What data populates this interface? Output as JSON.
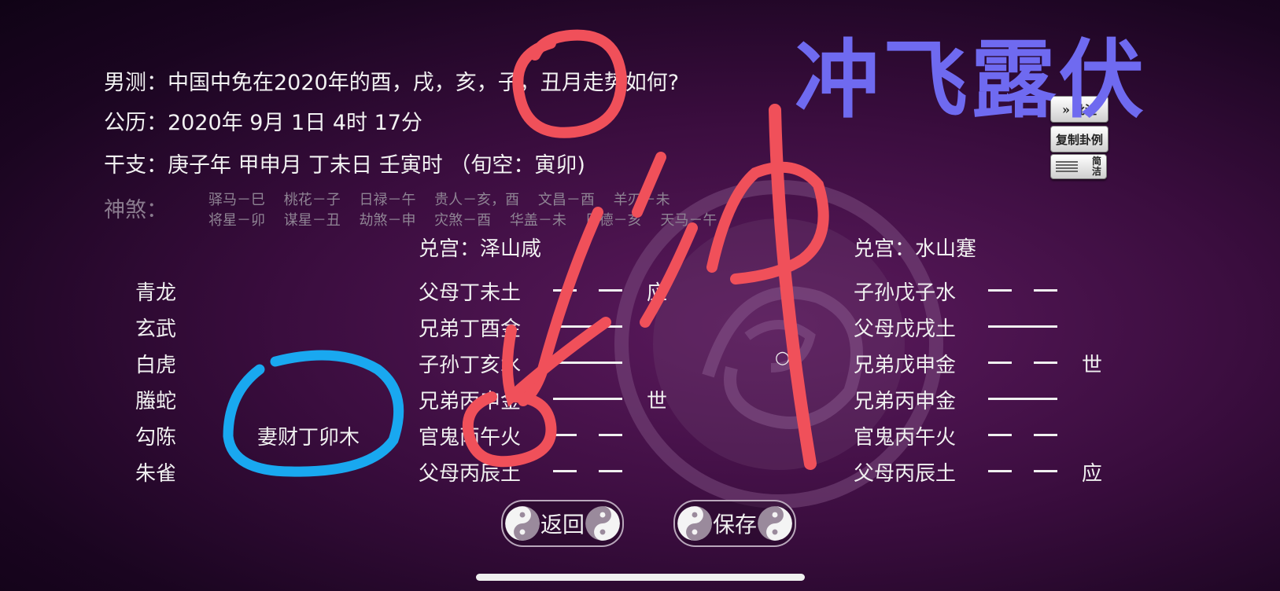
{
  "question": {
    "label": "男测：",
    "text": "中国中免在2020年的酉，戌，亥，子，丑月走势如何?"
  },
  "calendar": {
    "label": "公历：",
    "text": "2020年 9月 1日 4时 17分"
  },
  "ganzhi": {
    "label": "干支：",
    "text": "庚子年 甲申月 丁未日 壬寅时 （旬空：寅卯)"
  },
  "shensha": {
    "label": "神煞：",
    "row1": "驿马－巳　 桃花－子　 日禄－午　 贵人－亥，酉　 文昌－酉　 羊刃－未",
    "row2": "将星－卯　 谋星－丑　 劫煞－申　 灾煞－酉　 华盖－未　 日德－亥　 天马－午"
  },
  "main_hexagram": {
    "title": "兑宫：泽山咸"
  },
  "changed_hexagram": {
    "title": "兑宫：水山蹇"
  },
  "six_beasts": [
    "青龙",
    "玄武",
    "白虎",
    "螣蛇",
    "勾陈",
    "朱雀"
  ],
  "hidden_spirit": "妻财丁卯木",
  "main_lines": [
    {
      "text": "父母丁未土",
      "type": "yin",
      "marker": "应",
      "moving": ""
    },
    {
      "text": "兄弟丁酉金",
      "type": "yang",
      "marker": "",
      "moving": ""
    },
    {
      "text": "子孙丁亥水",
      "type": "yang",
      "marker": "",
      "moving": "○"
    },
    {
      "text": "兄弟丙申金",
      "type": "yang",
      "marker": "世",
      "moving": ""
    },
    {
      "text": "官鬼丙午火",
      "type": "yin",
      "marker": "",
      "moving": ""
    },
    {
      "text": "父母丙辰土",
      "type": "yin",
      "marker": "",
      "moving": ""
    }
  ],
  "changed_lines": [
    {
      "text": "子孙戊子水",
      "type": "yin",
      "marker": ""
    },
    {
      "text": "父母戊戌土",
      "type": "yang",
      "marker": ""
    },
    {
      "text": "兄弟戊申金",
      "type": "yin",
      "marker": "世"
    },
    {
      "text": "兄弟丙申金",
      "type": "yang",
      "marker": ""
    },
    {
      "text": "官鬼丙午火",
      "type": "yin",
      "marker": ""
    },
    {
      "text": "父母丙辰土",
      "type": "yin",
      "marker": "应"
    }
  ],
  "side_buttons": {
    "annotate": "批注",
    "copy_example": "复制卦例",
    "simple_line1": "简",
    "simple_line2": "洁"
  },
  "bottom_buttons": {
    "back": "返回",
    "save": "保存"
  },
  "overlay": {
    "title": "冲飞露伏",
    "handwriting": "冲"
  },
  "colors": {
    "annotation_red": "#f0505a",
    "annotation_blue": "#19a8f0",
    "title_blue": "#6f6af0"
  }
}
